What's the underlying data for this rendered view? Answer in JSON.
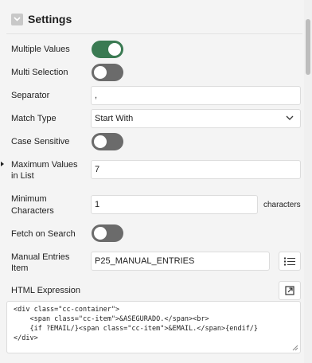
{
  "section": {
    "title": "Settings",
    "collapse_icon": "chevron-down-icon"
  },
  "fields": {
    "multiple_values": {
      "label": "Multiple Values",
      "checked": true
    },
    "multi_selection": {
      "label": "Multi Selection",
      "checked": false
    },
    "separator": {
      "label": "Separator",
      "value": ","
    },
    "match_type": {
      "label": "Match Type",
      "value": "Start With",
      "icon": "chevron-down-icon"
    },
    "case_sensitive": {
      "label": "Case Sensitive",
      "checked": false
    },
    "max_values": {
      "label_line1": "Maximum Values",
      "label_line2": "in List",
      "value": "7"
    },
    "min_chars": {
      "label_line1": "Minimum",
      "label_line2": "Characters",
      "value": "1",
      "suffix": "characters"
    },
    "fetch_on_search": {
      "label": "Fetch on Search",
      "checked": false
    },
    "manual_entries": {
      "label_line1": "Manual Entries",
      "label_line2": "Item",
      "value": "P25_MANUAL_ENTRIES",
      "icon": "list-icon"
    },
    "html_expression": {
      "label": "HTML Expression",
      "icon": "open-editor-icon",
      "lines": [
        "<div class=\"cc-container\">",
        "    <span class=\"cc-item\">&ASEGURADO.</span><br>",
        "    {if ?EMAIL/}<span class=\"cc-item\">&EMAIL.</span>{endif/}",
        "</div>"
      ]
    }
  },
  "colors": {
    "toggle_on": "#3a7a52",
    "toggle_off": "#6b6b6b"
  }
}
